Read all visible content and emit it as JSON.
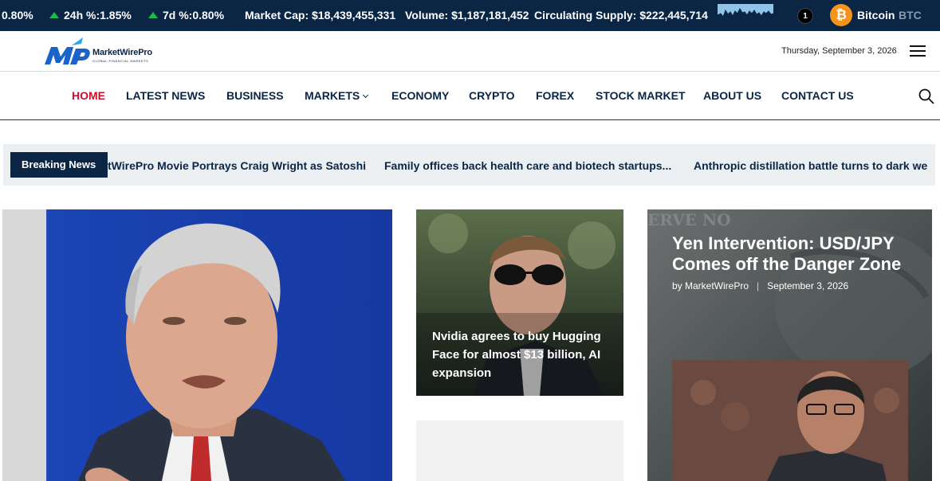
{
  "ticker": {
    "change_1h": "0.80%",
    "change_24h": "24h %:1.85%",
    "change_7d": "7d %:0.80%",
    "market_cap": "Market Cap: $18,439,455,331",
    "volume": "Volume: $1,187,181,452",
    "circulating_supply": "Circulating Supply: $222,445,714",
    "notification_count": "1",
    "coin_name": "Bitcoin",
    "coin_symbol": "BTC",
    "up_color": "#1fb84f",
    "bar_color": "#0b2545"
  },
  "header": {
    "logo_name": "MarketWirePro",
    "logo_tagline": "GLOBAL FINANCIAL MARKETS",
    "date": "Thursday, September 3, 2026"
  },
  "nav": {
    "items": [
      {
        "label": "HOME",
        "active": true
      },
      {
        "label": "LATEST NEWS"
      },
      {
        "label": "BUSINESS"
      },
      {
        "label": "MARKETS",
        "dropdown": true
      },
      {
        "label": "ECONOMY"
      },
      {
        "label": "CRYPTO"
      },
      {
        "label": "FOREX"
      },
      {
        "label": "STOCK MARKET"
      },
      {
        "label": "ABOUT US"
      },
      {
        "label": "CONTACT US"
      }
    ],
    "active_color": "#c8102e"
  },
  "breaking": {
    "label": "Breaking News",
    "items": [
      "tWirePro Movie Portrays Craig Wright as Satoshi",
      "Family offices back health care and biotech startups...",
      "Anthropic distillation battle turns to dark we"
    ]
  },
  "featured": {
    "middle": {
      "title": "Nvidia agrees to buy Hugging Face for almost $13 billion, AI expansion"
    },
    "right": {
      "title": "Yen Intervention: USD/JPY Comes off the Danger Zone",
      "author": "by MarketWirePro",
      "date": "September 3, 2026"
    }
  }
}
